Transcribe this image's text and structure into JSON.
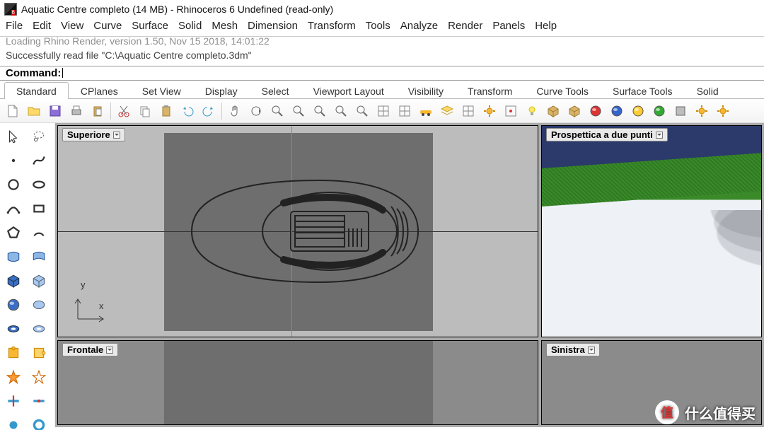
{
  "title": "Aquatic Centre completo (14 MB) - Rhinoceros 6 Undefined (read-only)",
  "menu": [
    "File",
    "Edit",
    "View",
    "Curve",
    "Surface",
    "Solid",
    "Mesh",
    "Dimension",
    "Transform",
    "Tools",
    "Analyze",
    "Render",
    "Panels",
    "Help"
  ],
  "history": {
    "line1": "Loading Rhino Render, version 1.50, Nov 15 2018, 14:01:22",
    "line2": "Successfully read file \"C:\\Aquatic Centre completo.3dm\""
  },
  "command_label": "Command:",
  "tabs": [
    "Standard",
    "CPlanes",
    "Set View",
    "Display",
    "Select",
    "Viewport Layout",
    "Visibility",
    "Transform",
    "Curve Tools",
    "Surface Tools",
    "Solid"
  ],
  "active_tab": 0,
  "viewports": {
    "top": "Superiore",
    "persp": "Prospettica a due punti",
    "front": "Frontale",
    "left": "Sinistra"
  },
  "axes": {
    "x": "x",
    "y": "y"
  },
  "watermark": {
    "badge": "值",
    "text": "什么值得买"
  },
  "htool_icons": [
    "new",
    "open",
    "save",
    "print",
    "paste",
    "cut",
    "copy",
    "clipboard",
    "undo",
    "redo",
    "pan",
    "rotate",
    "zoom",
    "zoom-ext",
    "zoom-win",
    "zoom-sel",
    "lasso",
    "render",
    "shade",
    "car",
    "layers",
    "grid",
    "options",
    "snap",
    "light",
    "box",
    "material",
    "sphere-r",
    "sphere-b",
    "sphere-y",
    "sphere-g",
    "cube",
    "gear",
    "gear2"
  ],
  "side_icons": [
    "pointer",
    "lasso",
    "point",
    "curve",
    "circle",
    "ellipse",
    "spline",
    "rect",
    "polygon",
    "arc",
    "surface",
    "loft",
    "box-blue",
    "box-lt",
    "sphere",
    "ellipsoid",
    "torus",
    "ring",
    "puzzle",
    "puzzle2",
    "star",
    "star-o",
    "trim",
    "join",
    "dot",
    "ring2"
  ]
}
